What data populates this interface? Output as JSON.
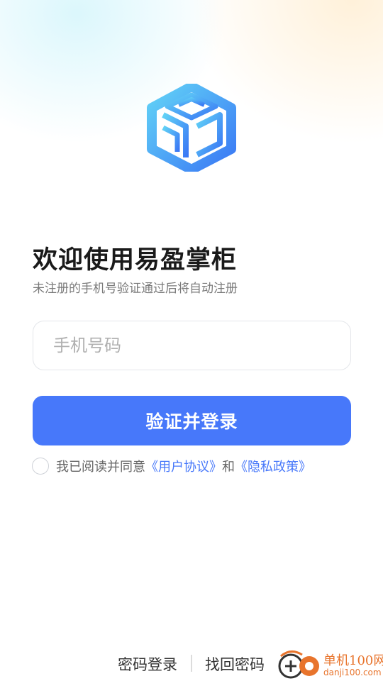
{
  "welcome": {
    "title": "欢迎使用易盈掌柜",
    "subtitle": "未注册的手机号验证通过后将自动注册"
  },
  "login_form": {
    "phone_placeholder": "手机号码",
    "phone_value": "",
    "submit_label": "验证并登录"
  },
  "agreement": {
    "checked": false,
    "prefix": "我已阅读并同意",
    "user_agreement": "《用户协议》",
    "and": "和",
    "privacy_policy": "《隐私政策》"
  },
  "footer": {
    "password_login": "密码登录",
    "recover_password": "找回密码"
  },
  "watermark": {
    "name": "单机100网",
    "url": "danji100.com"
  },
  "colors": {
    "primary": "#4778fa",
    "logo_gradient_start": "#5fd0f5",
    "logo_gradient_end": "#3d7df6",
    "watermark": "#e8742c"
  },
  "icons": {
    "logo": "cube-logo-icon",
    "checkbox": "checkbox-icon",
    "watermark_logo": "watermark-logo-icon"
  }
}
